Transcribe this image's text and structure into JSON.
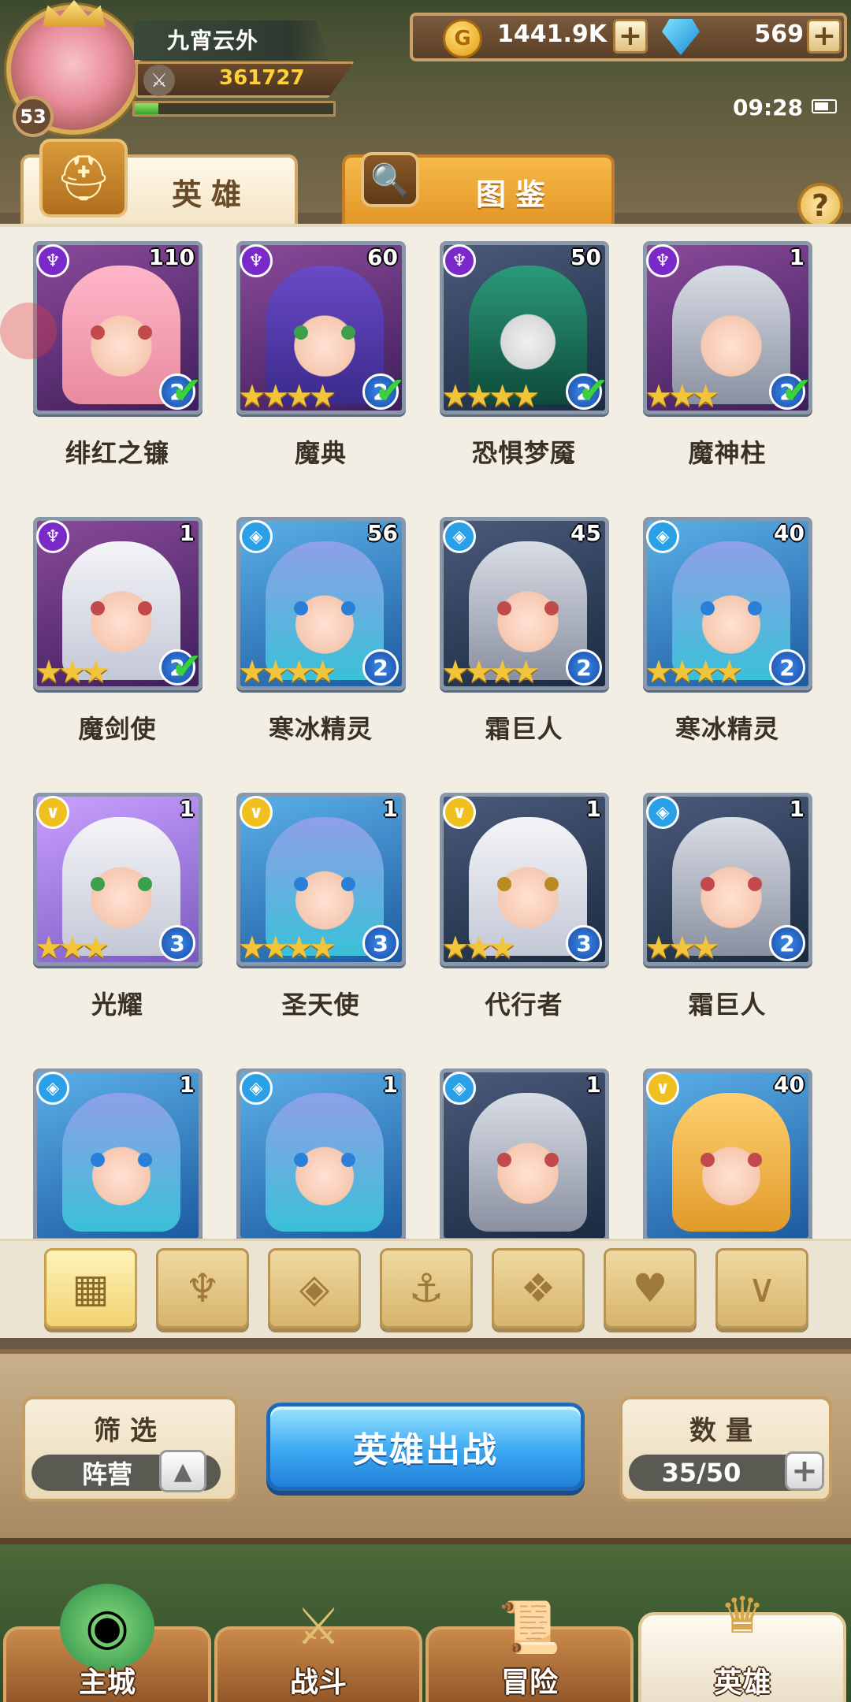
{
  "player": {
    "name": "九宵云外",
    "level": "53",
    "power": "361727",
    "exp_fraction": 0.12
  },
  "resources": {
    "gold": "1441.9K",
    "gems": "569",
    "plus_label": "+"
  },
  "status": {
    "time": "09:28"
  },
  "tabs": [
    {
      "label": "英雄",
      "icon": "knight-helmet-icon",
      "active": true
    },
    {
      "label": "图鉴",
      "icon": "magnifier-book-icon",
      "active": false
    }
  ],
  "help_label": "?",
  "heroes": [
    {
      "name": "绯红之镰",
      "level": "110",
      "class": "dark",
      "stars": "",
      "grade": "2",
      "deployed": true
    },
    {
      "name": "魔典",
      "level": "60",
      "class": "dark",
      "stars": "★★★★",
      "grade": "2",
      "deployed": true
    },
    {
      "name": "恐惧梦魇",
      "level": "50",
      "class": "dark",
      "stars": "★★★★",
      "grade": "2",
      "deployed": true
    },
    {
      "name": "魔神柱",
      "level": "1",
      "class": "dark",
      "stars": "★★★",
      "grade": "2",
      "deployed": true
    },
    {
      "name": "魔剑使",
      "level": "1",
      "class": "dark",
      "stars": "★★★",
      "grade": "2",
      "deployed": true
    },
    {
      "name": "寒冰精灵",
      "level": "56",
      "class": "water",
      "stars": "★★★★",
      "grade": "2",
      "deployed": false
    },
    {
      "name": "霜巨人",
      "level": "45",
      "class": "water",
      "stars": "★★★★",
      "grade": "2",
      "deployed": false
    },
    {
      "name": "寒冰精灵",
      "level": "40",
      "class": "water",
      "stars": "★★★★",
      "grade": "2",
      "deployed": false
    },
    {
      "name": "光耀",
      "level": "1",
      "class": "light",
      "stars": "★★★",
      "grade": "3",
      "deployed": false
    },
    {
      "name": "圣天使",
      "level": "1",
      "class": "light",
      "stars": "★★★★",
      "grade": "3",
      "deployed": false
    },
    {
      "name": "代行者",
      "level": "1",
      "class": "light",
      "stars": "★★★",
      "grade": "3",
      "deployed": false
    },
    {
      "name": "霜巨人",
      "level": "1",
      "class": "water",
      "stars": "★★★",
      "grade": "2",
      "deployed": false
    },
    {
      "name": "",
      "level": "1",
      "class": "water",
      "stars": "",
      "grade": "",
      "deployed": false
    },
    {
      "name": "",
      "level": "1",
      "class": "water",
      "stars": "",
      "grade": "",
      "deployed": false
    },
    {
      "name": "",
      "level": "1",
      "class": "water",
      "stars": "",
      "grade": "",
      "deployed": false
    },
    {
      "name": "",
      "level": "40",
      "class": "light",
      "stars": "",
      "grade": "",
      "deployed": false
    }
  ],
  "filters": [
    {
      "icon": "grid-all-icon",
      "active": true
    },
    {
      "icon": "leaf-nature-icon",
      "active": false
    },
    {
      "icon": "water-crystal-icon",
      "active": false
    },
    {
      "icon": "anchor-icon",
      "active": false
    },
    {
      "icon": "beast-head-icon",
      "active": false
    },
    {
      "icon": "demon-horns-icon",
      "active": false
    },
    {
      "icon": "light-wings-icon",
      "active": false
    }
  ],
  "filter_box": {
    "title": "筛选",
    "value": "阵营",
    "sort_icon": "triangle-up-icon"
  },
  "deploy_button": "英雄出战",
  "count_box": {
    "title": "数量",
    "value": "35/50"
  },
  "nav": [
    {
      "label": "主城",
      "icon": "castle-portal-icon",
      "active": false
    },
    {
      "label": "战斗",
      "icon": "crossed-swords-icon",
      "active": false
    },
    {
      "label": "冒险",
      "icon": "scroll-map-icon",
      "active": false
    },
    {
      "label": "英雄",
      "icon": "hero-helmet-icon",
      "active": true
    }
  ],
  "colors": {
    "accent_gold": "#f2c43a",
    "deploy_blue": "#3aa8f2",
    "panel_bg": "#f3eee3"
  }
}
